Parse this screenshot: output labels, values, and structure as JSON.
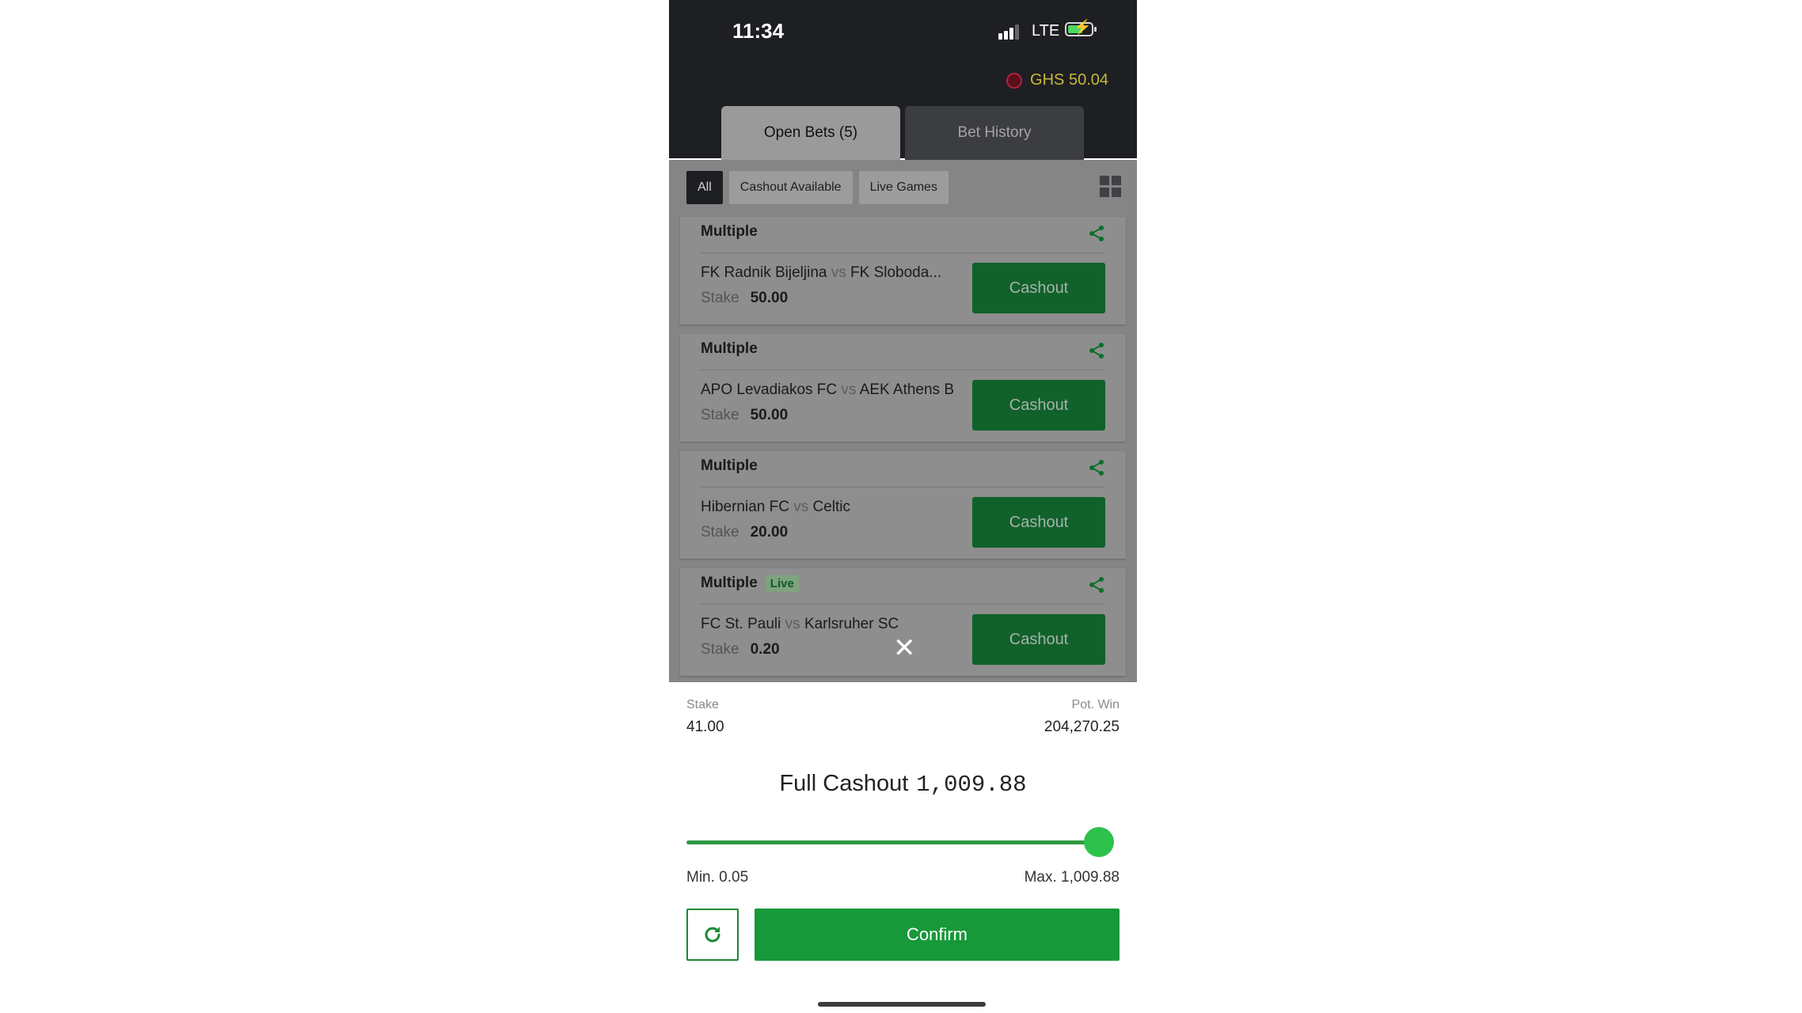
{
  "status": {
    "time": "11:34",
    "network": "LTE"
  },
  "header": {
    "balance": "GHS 50.04"
  },
  "tabs": [
    {
      "label": "Open Bets (5)",
      "active": true
    },
    {
      "label": "Bet History",
      "active": false
    }
  ],
  "filters": [
    {
      "label": "All",
      "active": true
    },
    {
      "label": "Cashout Available",
      "active": false
    },
    {
      "label": "Live Games",
      "active": false
    }
  ],
  "bets": [
    {
      "type": "Multiple",
      "live": false,
      "home": "FK Radnik Bijeljina",
      "vs": "vs",
      "away": "FK Sloboda...",
      "stake_label": "Stake",
      "stake": "50.00",
      "button": "Cashout"
    },
    {
      "type": "Multiple",
      "live": false,
      "home": "APO Levadiakos FC",
      "vs": "vs",
      "away": "AEK Athens B",
      "stake_label": "Stake",
      "stake": "50.00",
      "button": "Cashout"
    },
    {
      "type": "Multiple",
      "live": false,
      "home": "Hibernian FC",
      "vs": "vs",
      "away": "Celtic",
      "stake_label": "Stake",
      "stake": "20.00",
      "button": "Cashout"
    },
    {
      "type": "Multiple",
      "live": true,
      "live_label": "Live",
      "home": "FC St. Pauli",
      "vs": "vs",
      "away": "Karlsruher SC",
      "stake_label": "Stake",
      "stake": "0.20",
      "button": "Cashout"
    }
  ],
  "sheet": {
    "stake_label": "Stake",
    "stake_value": "41.00",
    "potwin_label": "Pot. Win",
    "potwin_value": "204,270.25",
    "full_cashout_label": "Full Cashout",
    "full_cashout_amount": "1,009.88",
    "slider_level": 1.0,
    "min_label": "Min. 0.05",
    "max_label": "Max. 1,009.88",
    "confirm_label": "Confirm"
  },
  "colors": {
    "accent_green": "#17993a",
    "cashout_green": "#11612b",
    "balance_gold": "#c8b73b"
  }
}
